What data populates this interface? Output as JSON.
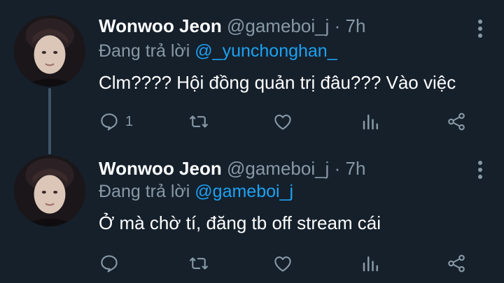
{
  "tweets": [
    {
      "name": "Wonwoo Jeon",
      "handle": "@gameboi_j",
      "separator": "·",
      "time": "7h",
      "reply_prefix": "Đang trả lời",
      "reply_to": "@_yunchonghan_",
      "text": "Clm???? Hội đồng quản trị đâu??? Vào việc",
      "reply_count": "1"
    },
    {
      "name": "Wonwoo Jeon",
      "handle": "@gameboi_j",
      "separator": "·",
      "time": "7h",
      "reply_prefix": "Đang trả lời",
      "reply_to": "@gameboi_j",
      "text": "Ở mà chờ tí, đăng tb off stream cái",
      "reply_count": ""
    }
  ],
  "icons": [
    "reply-icon",
    "retweet-icon",
    "like-icon",
    "stats-icon",
    "share-icon",
    "more-icon"
  ],
  "colors": {
    "background": "#15202b",
    "text": "#ffffff",
    "muted": "#8899a6",
    "link": "#1da1f2"
  }
}
